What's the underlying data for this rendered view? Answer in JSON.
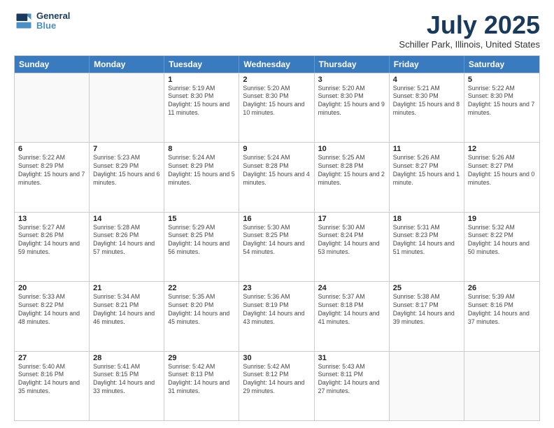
{
  "header": {
    "logo_line1": "General",
    "logo_line2": "Blue",
    "title": "July 2025",
    "subtitle": "Schiller Park, Illinois, United States"
  },
  "weekdays": [
    "Sunday",
    "Monday",
    "Tuesday",
    "Wednesday",
    "Thursday",
    "Friday",
    "Saturday"
  ],
  "weeks": [
    [
      {
        "day": "",
        "sunrise": "",
        "sunset": "",
        "daylight": ""
      },
      {
        "day": "",
        "sunrise": "",
        "sunset": "",
        "daylight": ""
      },
      {
        "day": "1",
        "sunrise": "Sunrise: 5:19 AM",
        "sunset": "Sunset: 8:30 PM",
        "daylight": "Daylight: 15 hours and 11 minutes."
      },
      {
        "day": "2",
        "sunrise": "Sunrise: 5:20 AM",
        "sunset": "Sunset: 8:30 PM",
        "daylight": "Daylight: 15 hours and 10 minutes."
      },
      {
        "day": "3",
        "sunrise": "Sunrise: 5:20 AM",
        "sunset": "Sunset: 8:30 PM",
        "daylight": "Daylight: 15 hours and 9 minutes."
      },
      {
        "day": "4",
        "sunrise": "Sunrise: 5:21 AM",
        "sunset": "Sunset: 8:30 PM",
        "daylight": "Daylight: 15 hours and 8 minutes."
      },
      {
        "day": "5",
        "sunrise": "Sunrise: 5:22 AM",
        "sunset": "Sunset: 8:30 PM",
        "daylight": "Daylight: 15 hours and 7 minutes."
      }
    ],
    [
      {
        "day": "6",
        "sunrise": "Sunrise: 5:22 AM",
        "sunset": "Sunset: 8:29 PM",
        "daylight": "Daylight: 15 hours and 7 minutes."
      },
      {
        "day": "7",
        "sunrise": "Sunrise: 5:23 AM",
        "sunset": "Sunset: 8:29 PM",
        "daylight": "Daylight: 15 hours and 6 minutes."
      },
      {
        "day": "8",
        "sunrise": "Sunrise: 5:24 AM",
        "sunset": "Sunset: 8:29 PM",
        "daylight": "Daylight: 15 hours and 5 minutes."
      },
      {
        "day": "9",
        "sunrise": "Sunrise: 5:24 AM",
        "sunset": "Sunset: 8:28 PM",
        "daylight": "Daylight: 15 hours and 4 minutes."
      },
      {
        "day": "10",
        "sunrise": "Sunrise: 5:25 AM",
        "sunset": "Sunset: 8:28 PM",
        "daylight": "Daylight: 15 hours and 2 minutes."
      },
      {
        "day": "11",
        "sunrise": "Sunrise: 5:26 AM",
        "sunset": "Sunset: 8:27 PM",
        "daylight": "Daylight: 15 hours and 1 minute."
      },
      {
        "day": "12",
        "sunrise": "Sunrise: 5:26 AM",
        "sunset": "Sunset: 8:27 PM",
        "daylight": "Daylight: 15 hours and 0 minutes."
      }
    ],
    [
      {
        "day": "13",
        "sunrise": "Sunrise: 5:27 AM",
        "sunset": "Sunset: 8:26 PM",
        "daylight": "Daylight: 14 hours and 59 minutes."
      },
      {
        "day": "14",
        "sunrise": "Sunrise: 5:28 AM",
        "sunset": "Sunset: 8:26 PM",
        "daylight": "Daylight: 14 hours and 57 minutes."
      },
      {
        "day": "15",
        "sunrise": "Sunrise: 5:29 AM",
        "sunset": "Sunset: 8:25 PM",
        "daylight": "Daylight: 14 hours and 56 minutes."
      },
      {
        "day": "16",
        "sunrise": "Sunrise: 5:30 AM",
        "sunset": "Sunset: 8:25 PM",
        "daylight": "Daylight: 14 hours and 54 minutes."
      },
      {
        "day": "17",
        "sunrise": "Sunrise: 5:30 AM",
        "sunset": "Sunset: 8:24 PM",
        "daylight": "Daylight: 14 hours and 53 minutes."
      },
      {
        "day": "18",
        "sunrise": "Sunrise: 5:31 AM",
        "sunset": "Sunset: 8:23 PM",
        "daylight": "Daylight: 14 hours and 51 minutes."
      },
      {
        "day": "19",
        "sunrise": "Sunrise: 5:32 AM",
        "sunset": "Sunset: 8:22 PM",
        "daylight": "Daylight: 14 hours and 50 minutes."
      }
    ],
    [
      {
        "day": "20",
        "sunrise": "Sunrise: 5:33 AM",
        "sunset": "Sunset: 8:22 PM",
        "daylight": "Daylight: 14 hours and 48 minutes."
      },
      {
        "day": "21",
        "sunrise": "Sunrise: 5:34 AM",
        "sunset": "Sunset: 8:21 PM",
        "daylight": "Daylight: 14 hours and 46 minutes."
      },
      {
        "day": "22",
        "sunrise": "Sunrise: 5:35 AM",
        "sunset": "Sunset: 8:20 PM",
        "daylight": "Daylight: 14 hours and 45 minutes."
      },
      {
        "day": "23",
        "sunrise": "Sunrise: 5:36 AM",
        "sunset": "Sunset: 8:19 PM",
        "daylight": "Daylight: 14 hours and 43 minutes."
      },
      {
        "day": "24",
        "sunrise": "Sunrise: 5:37 AM",
        "sunset": "Sunset: 8:18 PM",
        "daylight": "Daylight: 14 hours and 41 minutes."
      },
      {
        "day": "25",
        "sunrise": "Sunrise: 5:38 AM",
        "sunset": "Sunset: 8:17 PM",
        "daylight": "Daylight: 14 hours and 39 minutes."
      },
      {
        "day": "26",
        "sunrise": "Sunrise: 5:39 AM",
        "sunset": "Sunset: 8:16 PM",
        "daylight": "Daylight: 14 hours and 37 minutes."
      }
    ],
    [
      {
        "day": "27",
        "sunrise": "Sunrise: 5:40 AM",
        "sunset": "Sunset: 8:16 PM",
        "daylight": "Daylight: 14 hours and 35 minutes."
      },
      {
        "day": "28",
        "sunrise": "Sunrise: 5:41 AM",
        "sunset": "Sunset: 8:15 PM",
        "daylight": "Daylight: 14 hours and 33 minutes."
      },
      {
        "day": "29",
        "sunrise": "Sunrise: 5:42 AM",
        "sunset": "Sunset: 8:13 PM",
        "daylight": "Daylight: 14 hours and 31 minutes."
      },
      {
        "day": "30",
        "sunrise": "Sunrise: 5:42 AM",
        "sunset": "Sunset: 8:12 PM",
        "daylight": "Daylight: 14 hours and 29 minutes."
      },
      {
        "day": "31",
        "sunrise": "Sunrise: 5:43 AM",
        "sunset": "Sunset: 8:11 PM",
        "daylight": "Daylight: 14 hours and 27 minutes."
      },
      {
        "day": "",
        "sunrise": "",
        "sunset": "",
        "daylight": ""
      },
      {
        "day": "",
        "sunrise": "",
        "sunset": "",
        "daylight": ""
      }
    ]
  ]
}
